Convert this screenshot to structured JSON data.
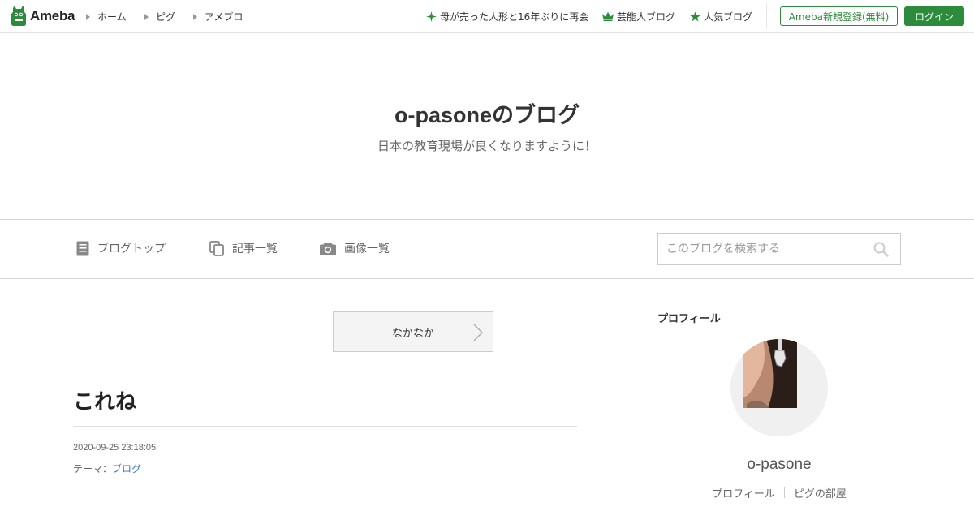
{
  "topbar": {
    "logo_text": "Ameba",
    "nav": [
      "ホーム",
      "ピグ",
      "アメブロ"
    ],
    "links": [
      {
        "label": "母が売った人形と16年ぶりに再会",
        "icon": "sparkle-icon"
      },
      {
        "label": "芸能人ブログ",
        "icon": "crown-icon"
      },
      {
        "label": "人気ブログ",
        "icon": "star-icon"
      }
    ],
    "register_label": "Ameba新規登録(無料)",
    "login_label": "ログイン",
    "accent_color": "#2d8c3c"
  },
  "header": {
    "title": "o-pasoneのブログ",
    "description": "日本の教育現場が良くなりますように！"
  },
  "blognav": {
    "items": [
      {
        "label": "ブログトップ",
        "icon": "document-icon"
      },
      {
        "label": "記事一覧",
        "icon": "copy-icon"
      },
      {
        "label": "画像一覧",
        "icon": "camera-icon"
      }
    ],
    "search_placeholder": "このブログを検索する"
  },
  "main": {
    "theme_button_label": "なかなか",
    "entry_title": "これね",
    "entry_date": "2020-09-25 23:18:05",
    "theme_prefix": "テーマ：",
    "theme_link": "ブログ"
  },
  "sidebar": {
    "heading": "プロフィール",
    "name": "o-pasone",
    "links": [
      "プロフィール",
      "ピグの部屋"
    ]
  }
}
